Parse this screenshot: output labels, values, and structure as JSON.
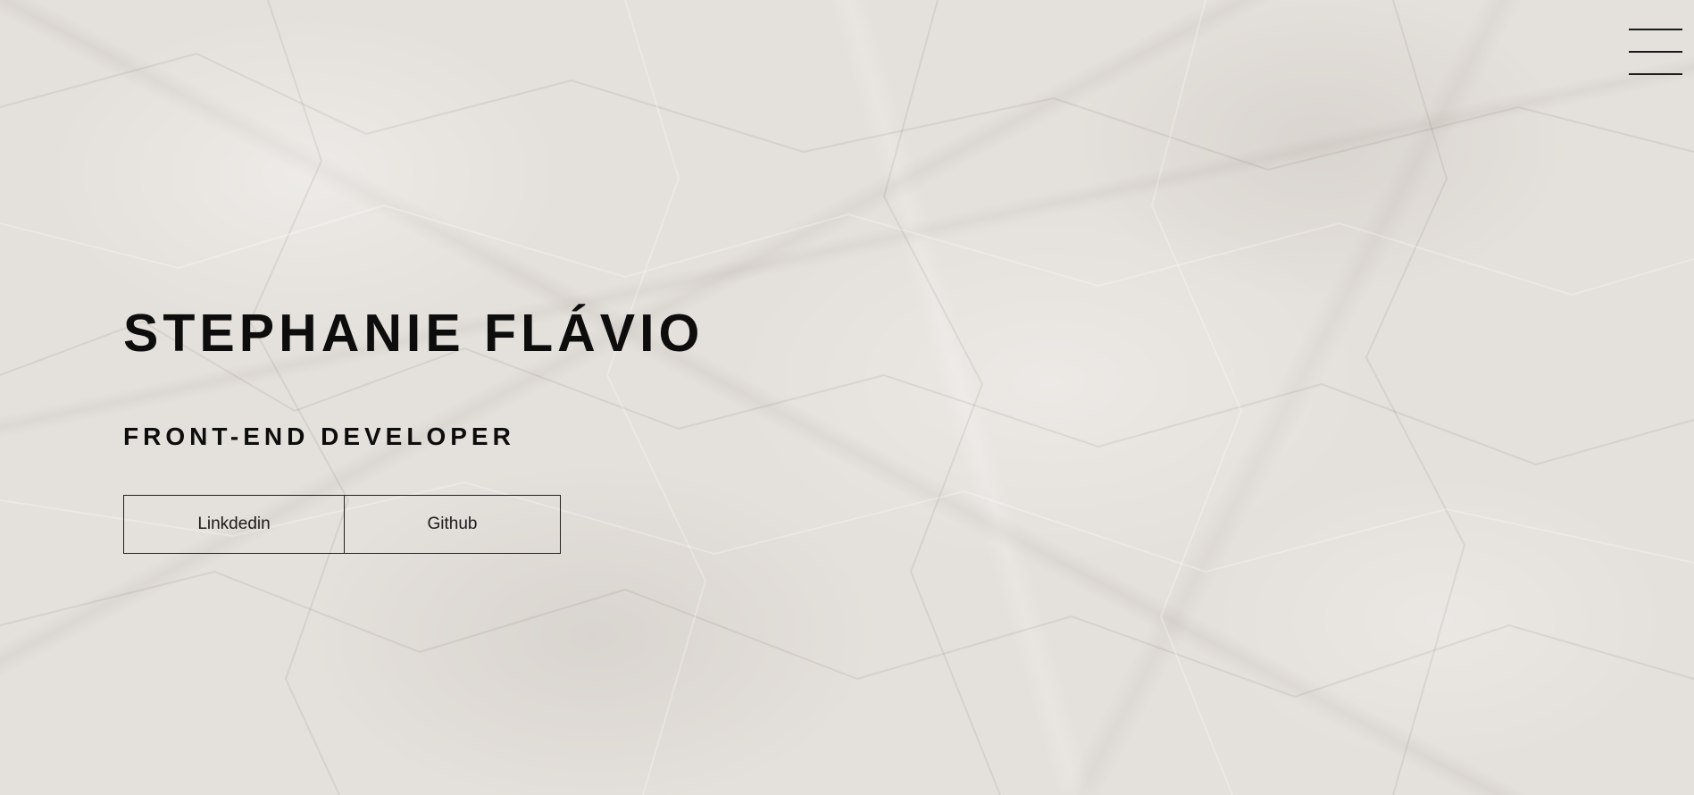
{
  "header": {
    "menu_icon": "hamburger-menu-icon"
  },
  "hero": {
    "name": "STEPHANIE FLÁVIO",
    "role": "FRONT-END DEVELOPER"
  },
  "links": {
    "linkedin_label": "Linkdedin",
    "github_label": "Github"
  },
  "colors": {
    "background": "#e4e0db",
    "text": "#0d0d0d",
    "border": "#222222"
  }
}
